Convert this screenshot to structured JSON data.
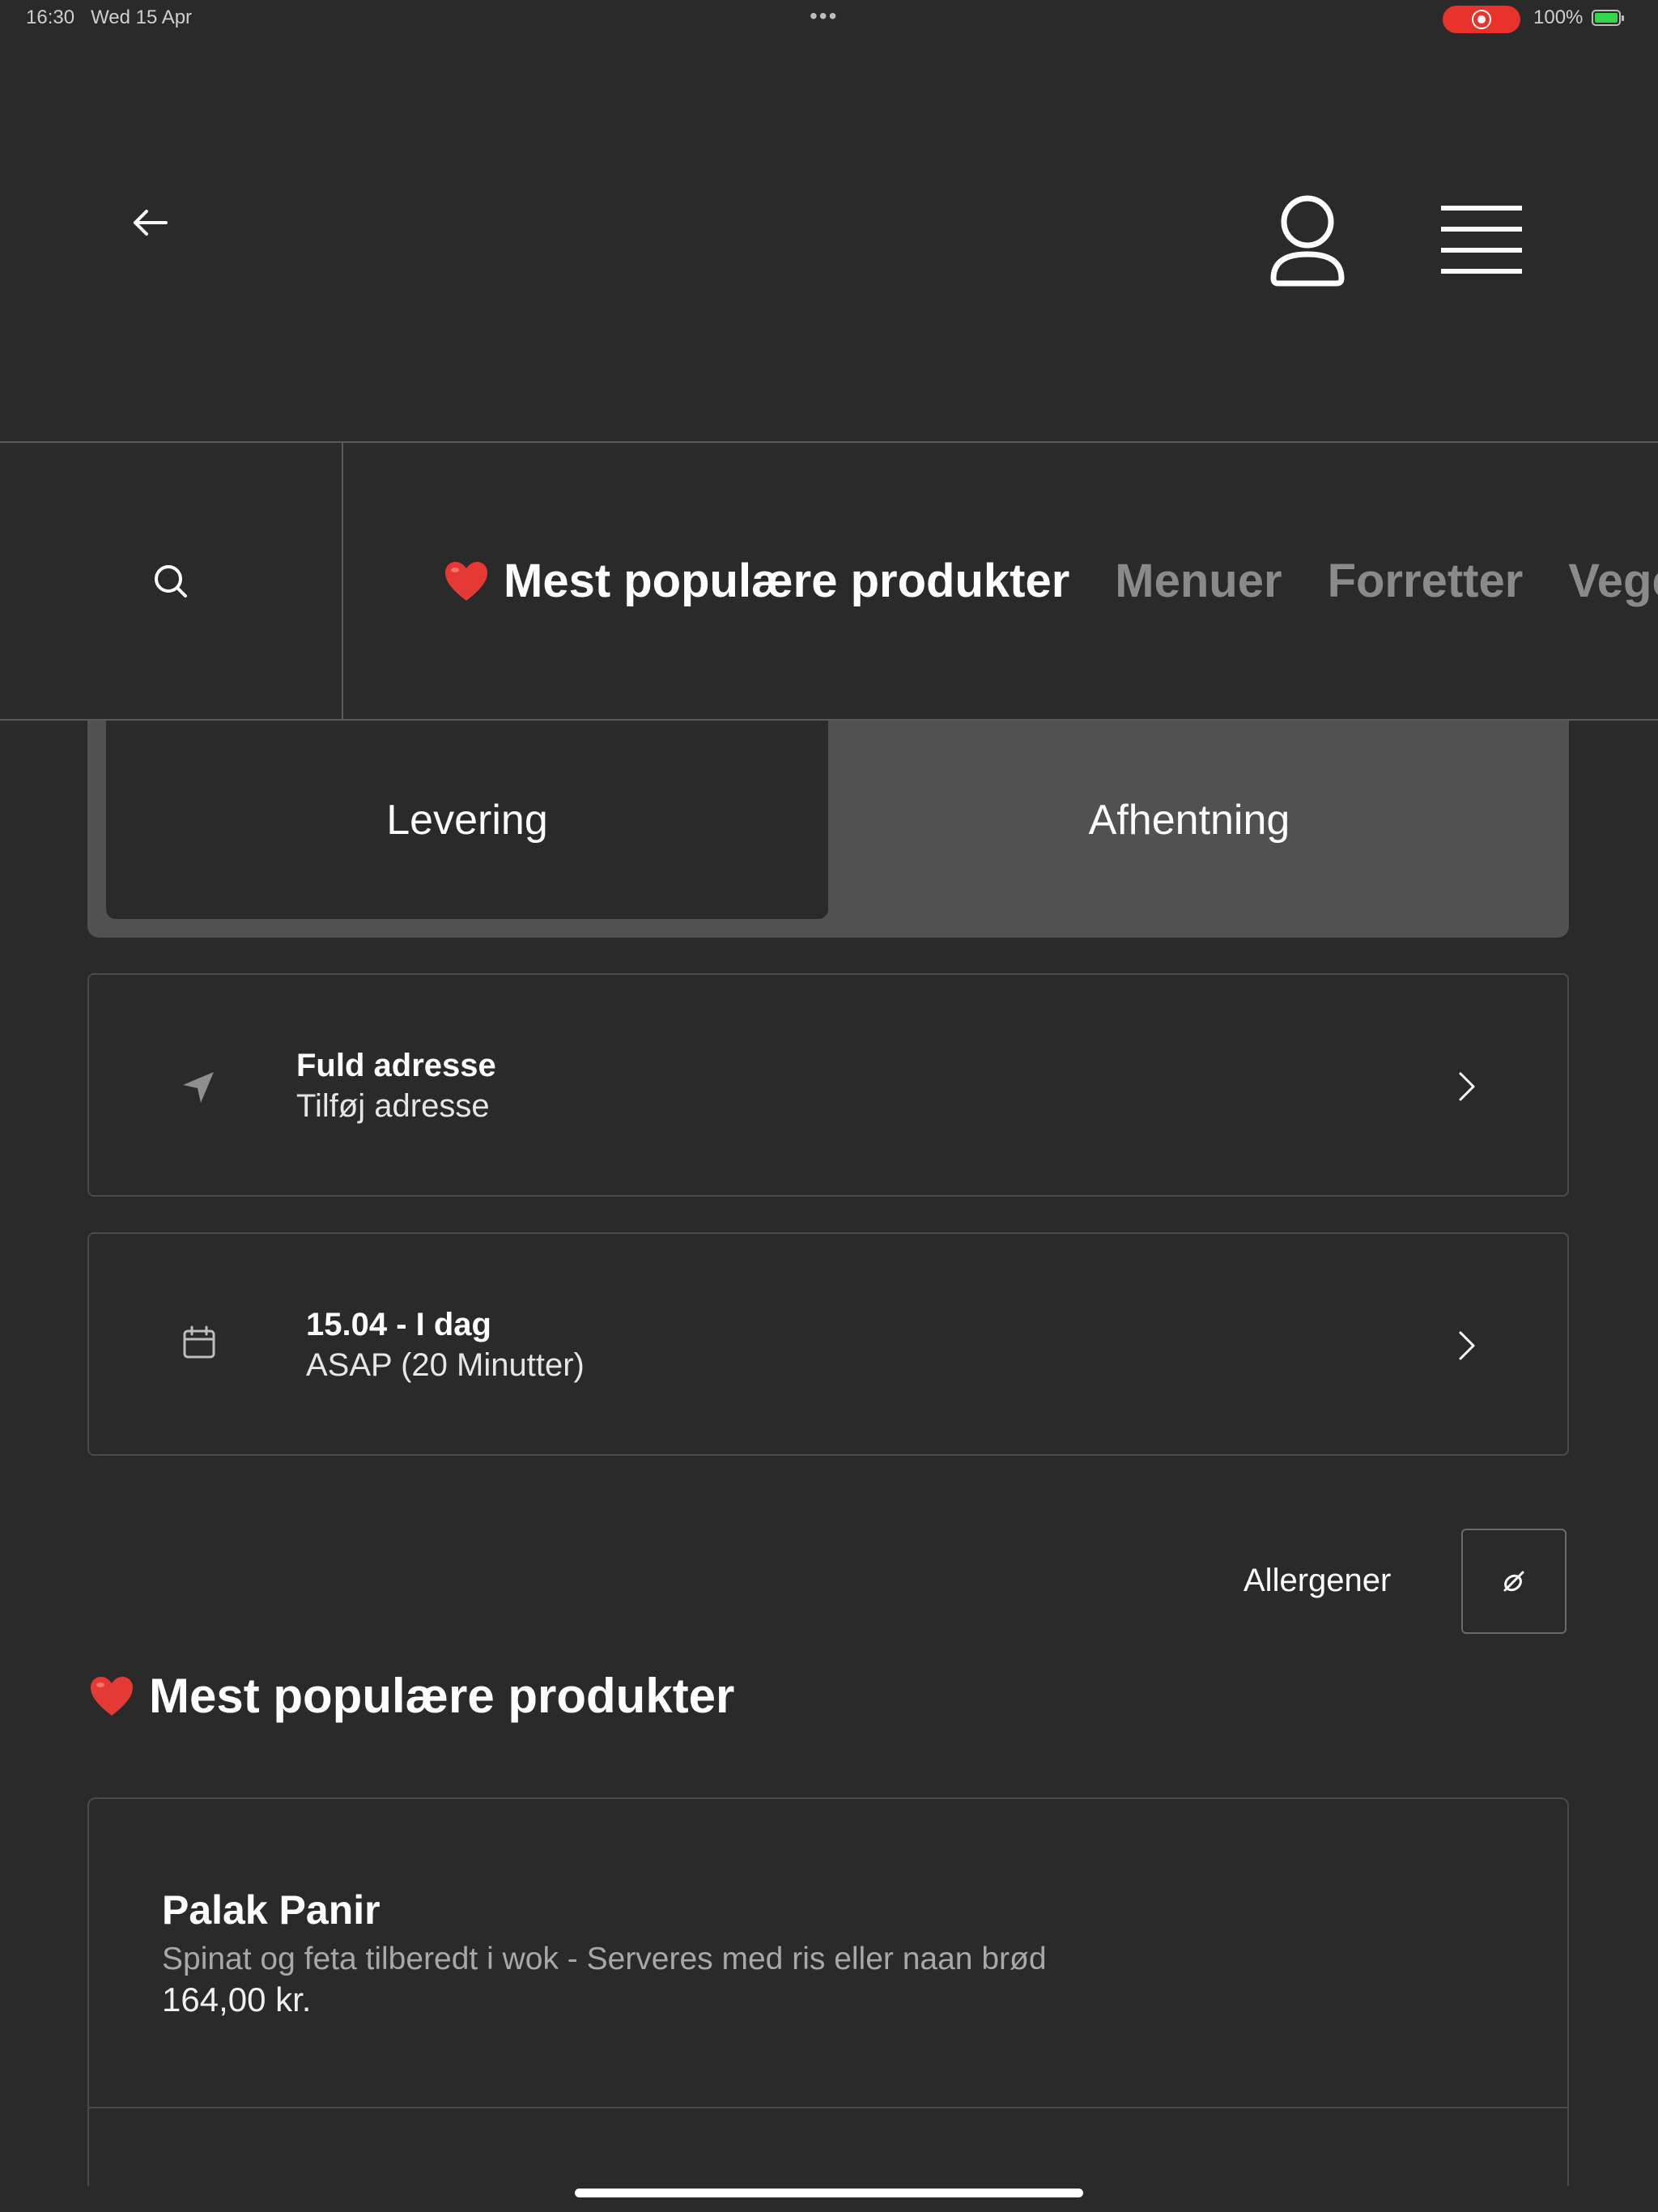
{
  "status_bar": {
    "time": "16:30",
    "date": "Wed 15 Apr",
    "dots": "•••",
    "battery_percent": "100%",
    "recording": true
  },
  "header": {
    "back_icon": "arrow-left-icon",
    "account_icon": "user-icon",
    "menu_icon": "hamburger-menu-icon"
  },
  "categories": {
    "search_icon": "search-icon",
    "tabs": [
      {
        "label": "Mest populære produkter",
        "active": true,
        "icon": "heart-icon"
      },
      {
        "label": "Menuer",
        "active": false
      },
      {
        "label": "Forretter",
        "active": false
      },
      {
        "label": "Vegetar",
        "active": false
      }
    ]
  },
  "order_type": {
    "delivery": "Levering",
    "pickup": "Afhentning",
    "selected": "delivery"
  },
  "address": {
    "title": "Fuld adresse",
    "subtitle": "Tilføj adresse",
    "icon": "location-arrow-icon"
  },
  "delivery_time": {
    "title": "15.04 - I dag",
    "subtitle": "ASAP (20 Minutter)",
    "icon": "calendar-icon"
  },
  "allergens": {
    "label": "Allergener",
    "icon": "allergen-filter-icon"
  },
  "section": {
    "title": "Mest populære produkter"
  },
  "products": [
    {
      "name": "Palak Panir",
      "description": "Spinat og feta tilberedt i wok - Serveres med ris eller naan brød",
      "price": "164,00 kr."
    }
  ],
  "colors": {
    "background": "#2a2a2a",
    "segment_bg": "#515151",
    "border": "#4a4a4a",
    "muted_text": "#8a8a8a",
    "heart": "#e53935"
  }
}
